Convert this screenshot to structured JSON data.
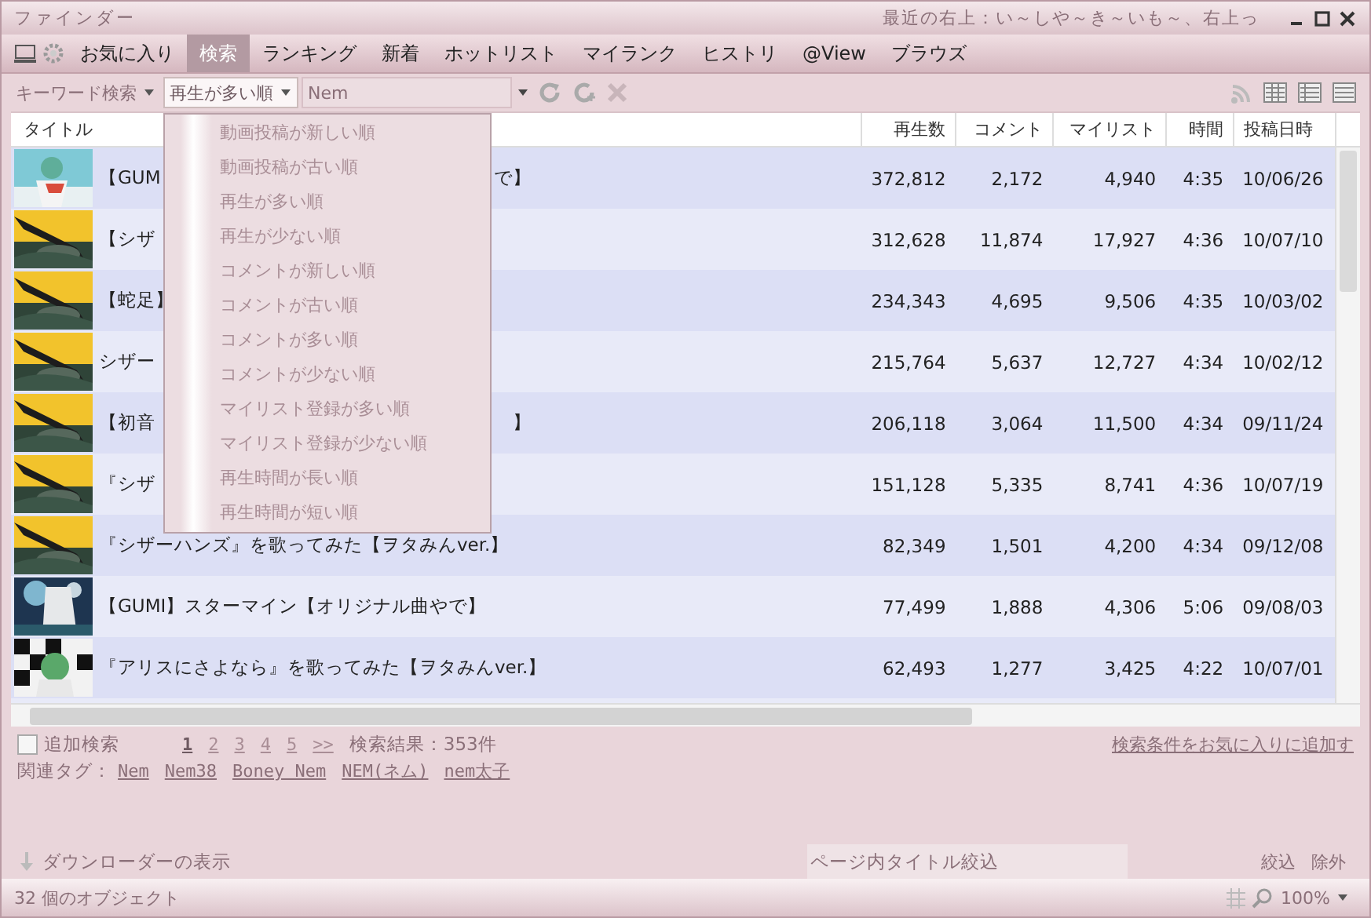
{
  "window": {
    "title": "ファインダー",
    "caption": "最近の右上：い～しや～き～いも～、右上っ"
  },
  "menu_tabs": [
    {
      "label": "お気に入り",
      "selected": false
    },
    {
      "label": "検索",
      "selected": true
    },
    {
      "label": "ランキング",
      "selected": false
    },
    {
      "label": "新着",
      "selected": false
    },
    {
      "label": "ホットリスト",
      "selected": false
    },
    {
      "label": "マイランク",
      "selected": false
    },
    {
      "label": "ヒストリ",
      "selected": false
    },
    {
      "label": "@View",
      "selected": false
    },
    {
      "label": "ブラウズ",
      "selected": false
    }
  ],
  "toolbar": {
    "search_mode": "キーワード検索",
    "sort": "再生が多い順",
    "query": "Nem"
  },
  "sort_menu": {
    "expanded": true,
    "items": [
      "動画投稿が新しい順",
      "動画投稿が古い順",
      "再生が多い順",
      "再生が少ない順",
      "コメントが新しい順",
      "コメントが古い順",
      "コメントが多い順",
      "コメントが少ない順",
      "マイリスト登録が多い順",
      "マイリスト登録が少ない順",
      "再生時間が長い順",
      "再生時間が短い順"
    ]
  },
  "table": {
    "columns": [
      "タイトル",
      "再生数",
      "コメント",
      "マイリスト",
      "時間",
      "投稿日時"
    ],
    "rows": [
      {
        "title": "【GUM",
        "title_end": "で】",
        "views": "372,812",
        "comments": "2,172",
        "mylists": "4,940",
        "length": "4:35",
        "posted": "10/06/26"
      },
      {
        "title": "【シザ",
        "views": "312,628",
        "comments": "11,874",
        "mylists": "17,927",
        "length": "4:36",
        "posted": "10/07/10"
      },
      {
        "title": "【蛇足】",
        "views": "234,343",
        "comments": "4,695",
        "mylists": "9,506",
        "length": "4:35",
        "posted": "10/03/02"
      },
      {
        "title": "シザー",
        "views": "215,764",
        "comments": "5,637",
        "mylists": "12,727",
        "length": "4:34",
        "posted": "10/02/12"
      },
      {
        "title": "【初音",
        "title_end": "】",
        "views": "206,118",
        "comments": "3,064",
        "mylists": "11,500",
        "length": "4:34",
        "posted": "09/11/24"
      },
      {
        "title": "『シザ",
        "views": "151,128",
        "comments": "5,335",
        "mylists": "8,741",
        "length": "4:36",
        "posted": "10/07/19"
      },
      {
        "title": "『シザーハンズ』を歌ってみた【ヲタみんver.】",
        "views": "82,349",
        "comments": "1,501",
        "mylists": "4,200",
        "length": "4:34",
        "posted": "09/12/08"
      },
      {
        "title": "【GUMI】スターマイン【オリジナル曲やで】",
        "views": "77,499",
        "comments": "1,888",
        "mylists": "4,306",
        "length": "5:06",
        "posted": "09/08/03"
      },
      {
        "title": "『アリスにさよなら』を歌ってみた【ヲタみんver.】",
        "views": "62,493",
        "comments": "1,277",
        "mylists": "3,425",
        "length": "4:22",
        "posted": "10/07/01"
      }
    ]
  },
  "search_footer": {
    "additional_search": {
      "label": "追加検索",
      "checked": false
    },
    "pages": [
      {
        "label": "1",
        "selected": true
      },
      {
        "label": "2",
        "selected": false
      },
      {
        "label": "3",
        "selected": false
      },
      {
        "label": "4",
        "selected": false
      },
      {
        "label": "5",
        "selected": false
      },
      {
        "label": ">>",
        "selected": false
      }
    ],
    "result_count": "検索結果：353件",
    "favorite_link": "検索条件をお気に入りに追加す",
    "related_tags_label": "関連タグ：",
    "related_tags": [
      "Nem",
      "Nem38",
      "Boney Nem",
      "NEM(ネム)",
      "nem太子"
    ]
  },
  "downloader": "ダウンローダーの表示",
  "filter": {
    "placeholder": "ページ内タイトル絞込",
    "buttons": [
      "絞込",
      "除外"
    ]
  },
  "status_bar": {
    "text": "32 個のオブジェクト",
    "zoom": "100%"
  }
}
